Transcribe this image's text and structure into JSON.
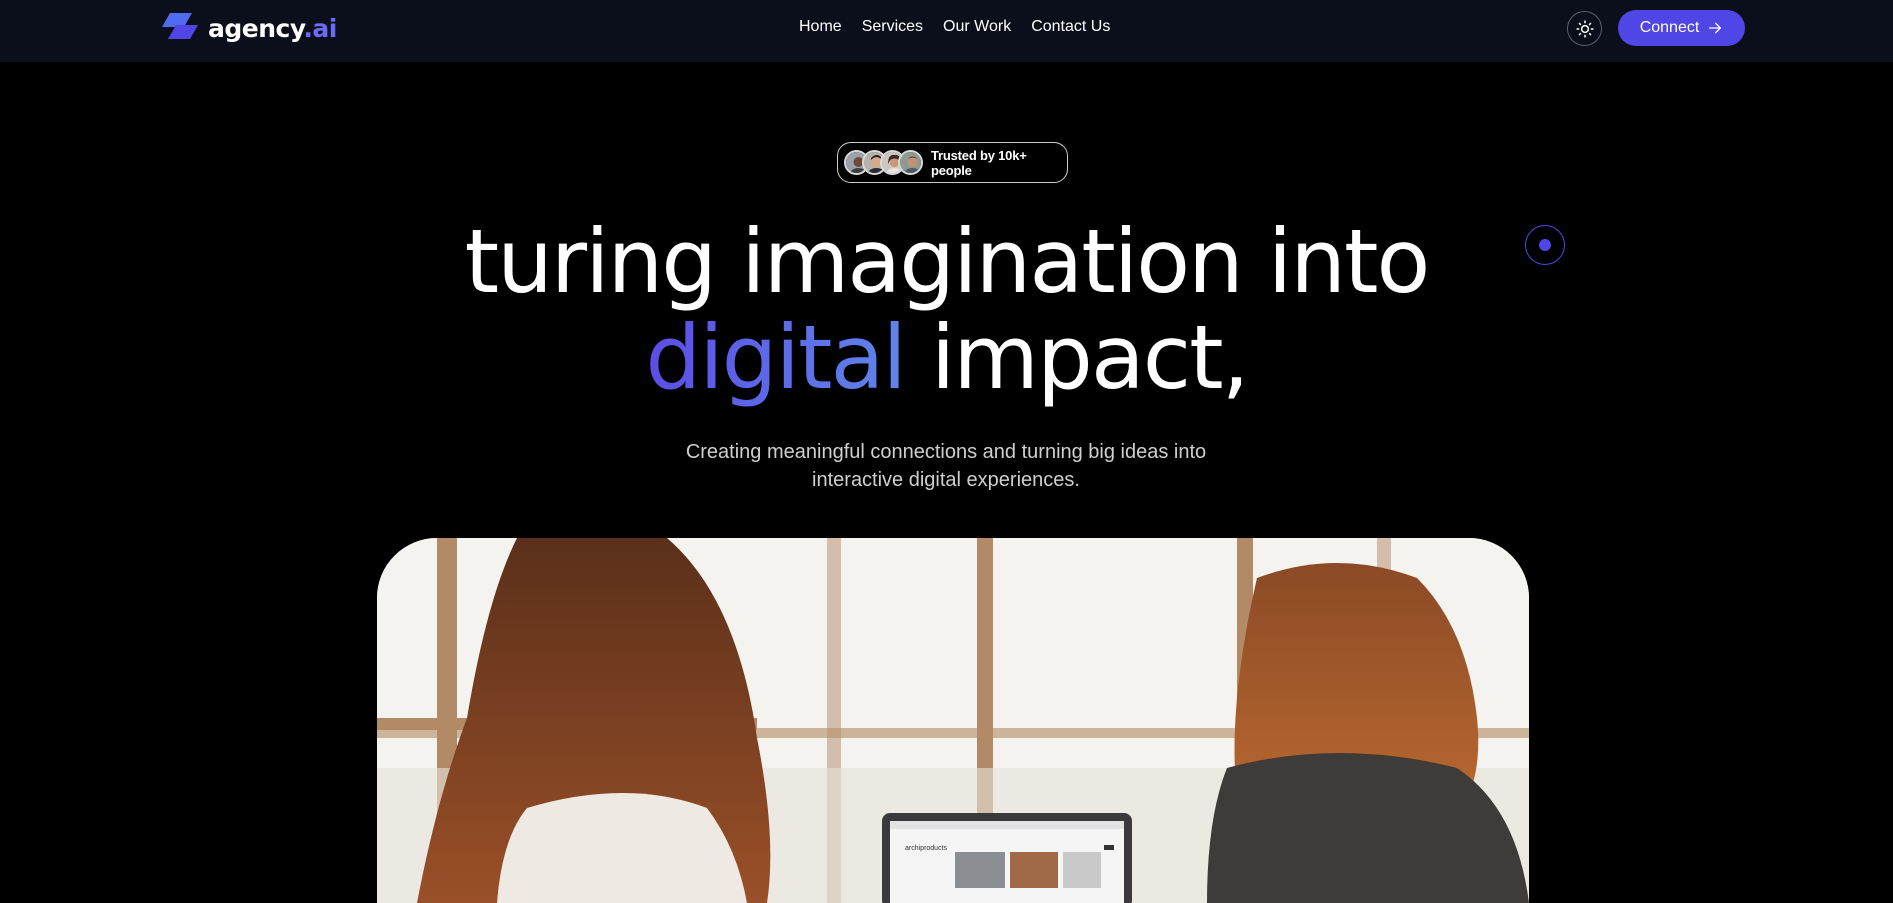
{
  "brand": {
    "name": "agency",
    "tld": ".ai",
    "logo_icon": "parallelogram-logo-icon",
    "accent_color": "#4f46e5"
  },
  "nav": {
    "links": [
      "Home",
      "Services",
      "Our Work",
      "Contact Us"
    ]
  },
  "header_actions": {
    "theme_icon": "sun-icon",
    "connect_label": "Connect",
    "connect_icon": "arrow-right-icon"
  },
  "hero": {
    "badge_text": "Trusted by 10k+ people",
    "title_line1": "turing imagination into",
    "title_accent": "digital",
    "title_line2_rest": " impact,",
    "subtitle": "Creating meaningful connections and turning big ideas into interactive digital experiences.",
    "laptop_screen_text": "archiproducts"
  },
  "colors": {
    "background": "#000000",
    "navbar": "#0b0f1c",
    "accent_start": "#5b4de6",
    "accent_end": "#5f86e8"
  }
}
